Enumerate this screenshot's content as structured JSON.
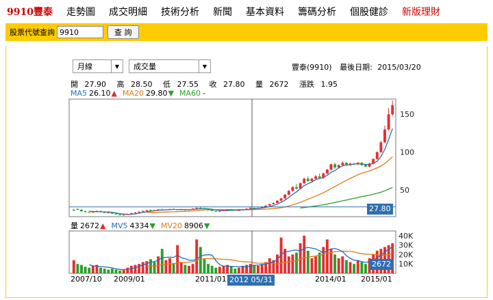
{
  "nav": [
    {
      "label": "9910豐泰",
      "kind": "brand"
    },
    {
      "label": "走勢圖",
      "kind": "normal"
    },
    {
      "label": "成交明細",
      "kind": "normal"
    },
    {
      "label": "技術分析",
      "kind": "normal"
    },
    {
      "label": "新聞",
      "kind": "normal"
    },
    {
      "label": "基本資料",
      "kind": "normal"
    },
    {
      "label": "籌碼分析",
      "kind": "normal"
    },
    {
      "label": "個股健診",
      "kind": "normal"
    },
    {
      "label": "新版理財",
      "kind": "new"
    }
  ],
  "query": {
    "label": "股票代號查詢",
    "value": "9910",
    "button": "查 詢"
  },
  "period_select": {
    "value": "月線",
    "arrow": "▼"
  },
  "indicator_select": {
    "value": "成交量",
    "arrow": "▼"
  },
  "stock": {
    "name": "豐泰(9910)",
    "last_date_label": "最後日期:",
    "last_date": "2015/03/20"
  },
  "ohlc": {
    "open_label": "開",
    "open": "27.90",
    "high_label": "高",
    "high": "28.50",
    "low_label": "低",
    "low": "27.55",
    "close_label": "收",
    "close": "27.80",
    "vol_label": "量",
    "vol": "2672",
    "chg_label": "漲跌",
    "chg": "1.95"
  },
  "ma_price": [
    {
      "label": "MA5",
      "value": "26.10",
      "arrow": "▲",
      "color": "#1f6fbf"
    },
    {
      "label": "MA20",
      "value": "29.80",
      "arrow": "▼",
      "color": "#e07b16"
    },
    {
      "label": "MA60",
      "value": "-",
      "arrow": "",
      "color": "#2aa02a"
    }
  ],
  "ma_volume": [
    {
      "label": "量",
      "value": "2672",
      "arrow": "▲",
      "color": "#000000"
    },
    {
      "label": "MV5",
      "value": "4334",
      "arrow": "▼",
      "color": "#1f6fbf"
    },
    {
      "label": "MV20",
      "value": "8906",
      "arrow": "▼",
      "color": "#e07b16"
    }
  ],
  "price_axis": [
    "150",
    "100",
    "50"
  ],
  "volume_axis": [
    "40K",
    "30K",
    "20K",
    "10K"
  ],
  "x_labels": [
    "2007/10",
    "2009/01",
    "2011/01",
    "2014/01",
    "2015/01"
  ],
  "crosshair_date": "2012 05/31",
  "price_tag": "27.80",
  "volume_tag": "2672",
  "colors": {
    "up": "#e23030",
    "down": "#2aa02a",
    "ma5": "#1f6fbf",
    "ma20": "#e07b16",
    "ma60": "#2aa02a",
    "accent": "#ffcc00",
    "tag": "#2f6fb0"
  },
  "chart_data": {
    "type": "bar",
    "price_ylim": [
      15,
      170
    ],
    "volume_ylim": [
      0,
      45000
    ],
    "candles": [
      [
        24,
        25,
        23,
        22.5
      ],
      [
        25,
        26,
        24,
        23.5
      ],
      [
        24,
        25,
        22,
        21.5
      ],
      [
        22,
        23,
        21,
        20.5
      ],
      [
        21,
        22,
        20.5,
        20
      ],
      [
        20.5,
        22,
        21.5,
        20
      ],
      [
        21.5,
        23,
        22.5,
        21
      ],
      [
        22.5,
        23,
        21.5,
        21
      ],
      [
        21.5,
        22,
        20,
        19.5
      ],
      [
        20,
        21,
        20.5,
        19.5
      ],
      [
        20.5,
        21,
        19,
        18.5
      ],
      [
        19,
        19.5,
        18,
        17.5
      ],
      [
        18,
        18.5,
        17,
        16.5
      ],
      [
        17,
        18,
        17.5,
        16.5
      ],
      [
        17.5,
        19,
        18.5,
        17
      ],
      [
        18.5,
        20,
        19.5,
        18
      ],
      [
        19.5,
        21,
        20.5,
        19
      ],
      [
        20.5,
        22,
        21.5,
        20
      ],
      [
        21.5,
        23,
        22.5,
        21
      ],
      [
        22.5,
        24,
        23.5,
        22
      ],
      [
        23.5,
        24.5,
        23,
        22.5
      ],
      [
        23,
        24,
        23.5,
        22.5
      ],
      [
        23.5,
        25,
        24.5,
        23
      ],
      [
        24.5,
        25.5,
        24,
        23.5
      ],
      [
        24,
        25,
        24.5,
        23.5
      ],
      [
        24.5,
        25.5,
        25,
        24
      ],
      [
        25,
        26,
        24.5,
        24
      ],
      [
        24.5,
        25,
        24,
        23.5
      ],
      [
        24,
        25,
        24.5,
        23.5
      ],
      [
        24.5,
        25,
        24,
        23
      ],
      [
        24,
        25,
        24.5,
        23.5
      ],
      [
        24.5,
        26,
        25.5,
        24
      ],
      [
        25.5,
        27,
        26.5,
        25
      ],
      [
        26.5,
        27.5,
        26,
        25.5
      ],
      [
        26,
        26.5,
        25,
        24.5
      ],
      [
        25,
        25.5,
        24,
        23
      ],
      [
        24,
        24.5,
        22.5,
        22
      ],
      [
        22.5,
        23,
        22,
        21
      ],
      [
        22,
        23,
        22.5,
        21.5
      ],
      [
        22.5,
        24,
        23.5,
        22
      ],
      [
        23.5,
        25,
        24.5,
        23
      ],
      [
        24.5,
        25,
        24,
        23.5
      ],
      [
        24,
        24.5,
        23,
        22.5
      ],
      [
        23,
        24,
        23.5,
        22.5
      ],
      [
        23.5,
        25,
        24.5,
        23
      ],
      [
        24.5,
        26,
        25.5,
        24
      ],
      [
        25.5,
        27,
        26.5,
        25
      ],
      [
        26.5,
        27,
        26,
        25.5
      ],
      [
        26,
        27,
        26.5,
        25.5
      ],
      [
        26.5,
        28,
        27.5,
        26
      ],
      [
        27.5,
        30,
        29.5,
        27
      ],
      [
        29.5,
        32,
        31.5,
        29
      ],
      [
        31.5,
        34,
        33,
        31
      ],
      [
        33,
        37,
        36,
        32.5
      ],
      [
        36,
        40,
        39,
        35
      ],
      [
        39,
        45,
        44,
        38
      ],
      [
        44,
        50,
        49,
        43
      ],
      [
        49,
        55,
        54,
        48
      ],
      [
        54,
        58,
        52,
        51
      ],
      [
        52,
        60,
        59,
        51
      ],
      [
        59,
        66,
        65,
        58
      ],
      [
        65,
        68,
        62,
        61
      ],
      [
        62,
        66,
        65,
        60
      ],
      [
        65,
        70,
        68,
        64
      ],
      [
        68,
        72,
        66,
        65
      ],
      [
        66,
        73,
        72,
        65
      ],
      [
        72,
        78,
        77,
        71
      ],
      [
        77,
        85,
        84,
        76
      ],
      [
        84,
        86,
        80,
        78
      ],
      [
        80,
        84,
        83,
        79
      ],
      [
        83,
        88,
        86,
        82
      ],
      [
        86,
        87,
        83,
        82
      ],
      [
        83,
        86,
        85,
        82
      ],
      [
        85,
        86,
        84,
        83
      ],
      [
        84,
        87,
        86,
        83
      ],
      [
        86,
        87,
        83,
        82
      ],
      [
        83,
        84,
        81,
        80
      ],
      [
        81,
        86,
        85,
        80
      ],
      [
        85,
        92,
        91,
        84
      ],
      [
        91,
        101,
        100,
        90
      ],
      [
        100,
        115,
        113,
        99
      ],
      [
        113,
        135,
        130,
        112
      ],
      [
        130,
        158,
        150,
        128
      ],
      [
        150,
        168,
        162,
        148
      ]
    ],
    "volumes": [
      14000,
      10000,
      9000,
      7000,
      6000,
      8000,
      9000,
      6000,
      5000,
      4000,
      5000,
      4000,
      3000,
      3500,
      6000,
      8000,
      9000,
      10000,
      12000,
      13000,
      15000,
      12000,
      18000,
      26000,
      14000,
      16000,
      11000,
      30000,
      12000,
      9000,
      8000,
      10000,
      36000,
      28000,
      15000,
      10000,
      8000,
      6000,
      7000,
      8000,
      9000,
      7000,
      5000,
      6000,
      8000,
      9000,
      10000,
      9000,
      8000,
      10000,
      12000,
      16000,
      14000,
      20000,
      38000,
      26000,
      18000,
      20000,
      22000,
      32000,
      40000,
      24000,
      16000,
      18000,
      22000,
      28000,
      36000,
      26000,
      20000,
      16000,
      18000,
      14000,
      12000,
      10000,
      14000,
      12000,
      10000,
      16000,
      20000,
      24000,
      26000,
      28000,
      30000,
      32000
    ],
    "volume_up": [
      1,
      0,
      0,
      0,
      0,
      1,
      1,
      0,
      0,
      0,
      0,
      0,
      0,
      1,
      1,
      1,
      1,
      1,
      1,
      1,
      0,
      0,
      1,
      0,
      1,
      1,
      0,
      1,
      1,
      0,
      1,
      1,
      1,
      0,
      0,
      0,
      0,
      0,
      1,
      1,
      1,
      0,
      0,
      1,
      1,
      1,
      1,
      0,
      1,
      1,
      1,
      1,
      1,
      1,
      1,
      1,
      1,
      1,
      0,
      1,
      1,
      0,
      1,
      1,
      0,
      1,
      1,
      1,
      0,
      1,
      1,
      0,
      1,
      0,
      1,
      0,
      0,
      1,
      1,
      1,
      1,
      1,
      1,
      1
    ]
  }
}
